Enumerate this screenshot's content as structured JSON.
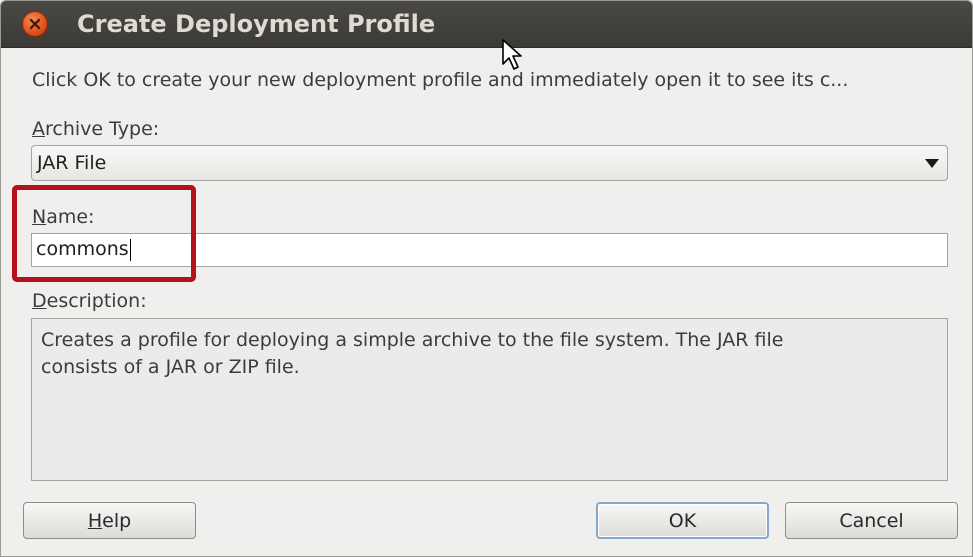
{
  "window": {
    "title": "Create Deployment Profile",
    "close_icon": "close-icon"
  },
  "instruction": "Click OK to create your new deployment profile and immediately open it to see its c...",
  "archive_type": {
    "label_mnemonic": "A",
    "label_rest": "rchive Type:",
    "selected": "JAR File"
  },
  "name": {
    "label_mnemonic": "N",
    "label_rest": "ame:",
    "value": "commons"
  },
  "description": {
    "label_mnemonic": "D",
    "label_rest": "escription:",
    "line1": "Creates a profile for deploying a simple archive to the file system. The JAR file",
    "line2": "consists of a JAR or ZIP file."
  },
  "buttons": {
    "help_mnemonic": "H",
    "help_rest": "elp",
    "ok": "OK",
    "cancel": "Cancel"
  },
  "colors": {
    "highlight": "#b3111c",
    "titlebar": "#3b3a36",
    "close_button": "#de4c16"
  }
}
